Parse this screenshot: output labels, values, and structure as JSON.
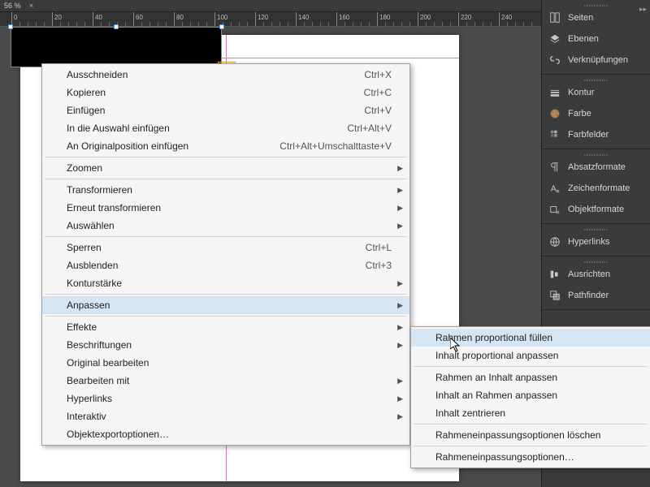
{
  "tab": {
    "zoom": "56 %",
    "close": "×"
  },
  "ruler": {
    "start": 0,
    "step": 20,
    "count": 13
  },
  "panels": [
    {
      "group": [
        {
          "name": "seiten",
          "label": "Seiten",
          "icon": "pages"
        },
        {
          "name": "ebenen",
          "label": "Ebenen",
          "icon": "layers"
        },
        {
          "name": "verknuepfungen",
          "label": "Verknüpfungen",
          "icon": "links"
        }
      ]
    },
    {
      "group": [
        {
          "name": "kontur",
          "label": "Kontur",
          "icon": "stroke"
        },
        {
          "name": "farbe",
          "label": "Farbe",
          "icon": "color"
        },
        {
          "name": "farbfelder",
          "label": "Farbfelder",
          "icon": "swatches"
        }
      ]
    },
    {
      "group": [
        {
          "name": "absatzformate",
          "label": "Absatzformate",
          "icon": "parastyle"
        },
        {
          "name": "zeichenformate",
          "label": "Zeichenformate",
          "icon": "charstyle"
        },
        {
          "name": "objektformate",
          "label": "Objektformate",
          "icon": "objstyle"
        }
      ]
    },
    {
      "group": [
        {
          "name": "hyperlinks",
          "label": "Hyperlinks",
          "icon": "hyperlink"
        }
      ]
    },
    {
      "group": [
        {
          "name": "ausrichten",
          "label": "Ausrichten",
          "icon": "align"
        },
        {
          "name": "pathfinder",
          "label": "Pathfinder",
          "icon": "pathfinder"
        }
      ]
    }
  ],
  "menu": {
    "items": [
      {
        "label": "Ausschneiden",
        "shortcut": "Ctrl+X"
      },
      {
        "label": "Kopieren",
        "shortcut": "Ctrl+C"
      },
      {
        "label": "Einfügen",
        "shortcut": "Ctrl+V"
      },
      {
        "label": "In die Auswahl einfügen",
        "shortcut": "Ctrl+Alt+V"
      },
      {
        "label": "An Originalposition einfügen",
        "shortcut": "Ctrl+Alt+Umschalttaste+V",
        "sepAfter": true
      },
      {
        "label": "Zoomen",
        "submenu": true,
        "sepAfter": true
      },
      {
        "label": "Transformieren",
        "submenu": true
      },
      {
        "label": "Erneut transformieren",
        "submenu": true
      },
      {
        "label": "Auswählen",
        "submenu": true,
        "sepAfter": true
      },
      {
        "label": "Sperren",
        "shortcut": "Ctrl+L"
      },
      {
        "label": "Ausblenden",
        "shortcut": "Ctrl+3"
      },
      {
        "label": "Konturstärke",
        "submenu": true,
        "sepAfter": true
      },
      {
        "label": "Anpassen",
        "submenu": true,
        "highlight": true,
        "sepAfter": true
      },
      {
        "label": "Effekte",
        "submenu": true
      },
      {
        "label": "Beschriftungen",
        "submenu": true
      },
      {
        "label": "Original bearbeiten"
      },
      {
        "label": "Bearbeiten mit",
        "submenu": true
      },
      {
        "label": "Hyperlinks",
        "submenu": true
      },
      {
        "label": "Interaktiv",
        "submenu": true
      },
      {
        "label": "Objektexportoptionen…"
      }
    ]
  },
  "submenu": {
    "items": [
      {
        "label": "Rahmen proportional füllen",
        "highlight": true
      },
      {
        "label": "Inhalt proportional anpassen",
        "sepAfter": true
      },
      {
        "label": "Rahmen an Inhalt anpassen"
      },
      {
        "label": "Inhalt an Rahmen anpassen"
      },
      {
        "label": "Inhalt zentrieren",
        "sepAfter": true
      },
      {
        "label": "Rahmeneinpassungsoptionen löschen",
        "sepAfter": true
      },
      {
        "label": "Rahmeneinpassungsoptionen…"
      }
    ]
  }
}
